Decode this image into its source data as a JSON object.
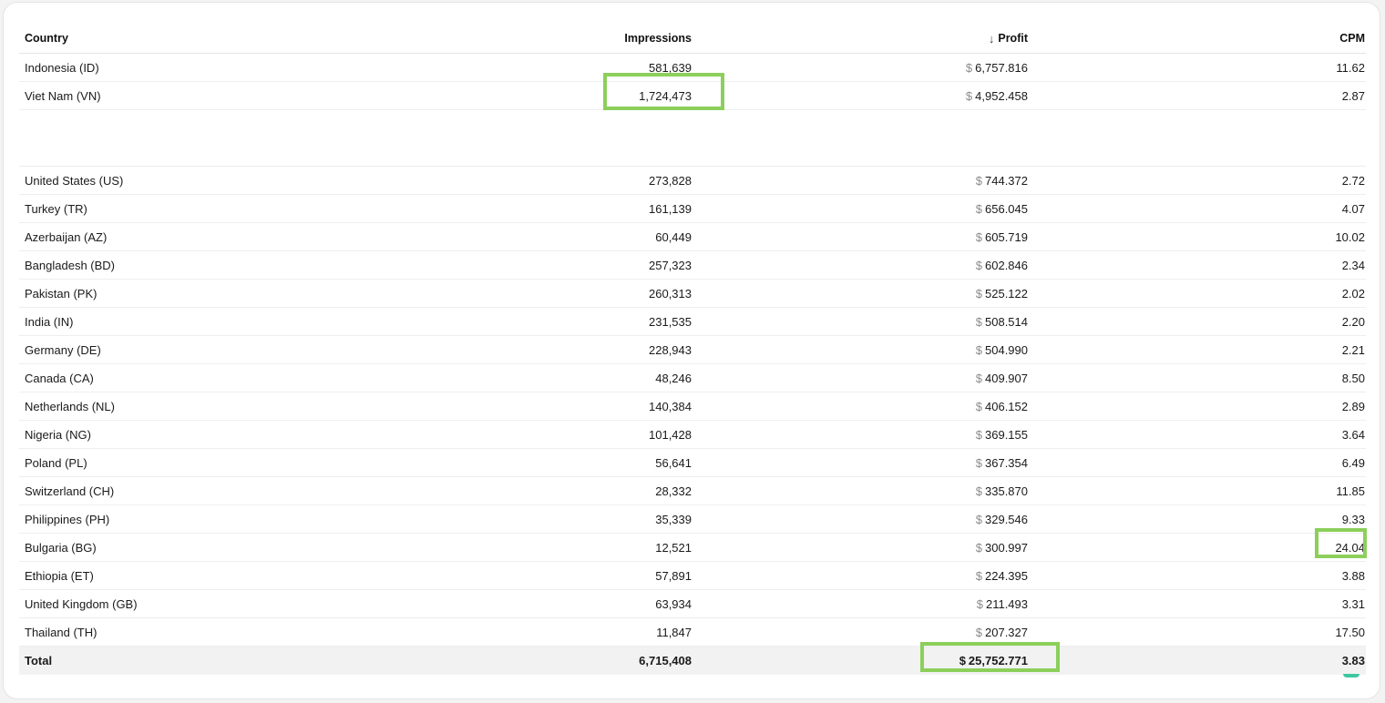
{
  "table": {
    "headers": {
      "country": "Country",
      "impressions": "Impressions",
      "profit": "Profit",
      "cpm": "CPM",
      "sort_icon": "arrow-down-icon"
    },
    "currency_symbol": "$",
    "rows_top": [
      {
        "country": "Indonesia (ID)",
        "impressions": "581,639",
        "profit": "6,757.816",
        "cpm": "11.62"
      },
      {
        "country": "Viet Nam (VN)",
        "impressions": "1,724,473",
        "profit": "4,952.458",
        "cpm": "2.87"
      }
    ],
    "rows": [
      {
        "country": "United States (US)",
        "impressions": "273,828",
        "profit": "744.372",
        "cpm": "2.72"
      },
      {
        "country": "Turkey (TR)",
        "impressions": "161,139",
        "profit": "656.045",
        "cpm": "4.07"
      },
      {
        "country": "Azerbaijan (AZ)",
        "impressions": "60,449",
        "profit": "605.719",
        "cpm": "10.02"
      },
      {
        "country": "Bangladesh (BD)",
        "impressions": "257,323",
        "profit": "602.846",
        "cpm": "2.34"
      },
      {
        "country": "Pakistan (PK)",
        "impressions": "260,313",
        "profit": "525.122",
        "cpm": "2.02"
      },
      {
        "country": "India (IN)",
        "impressions": "231,535",
        "profit": "508.514",
        "cpm": "2.20"
      },
      {
        "country": "Germany (DE)",
        "impressions": "228,943",
        "profit": "504.990",
        "cpm": "2.21"
      },
      {
        "country": "Canada (CA)",
        "impressions": "48,246",
        "profit": "409.907",
        "cpm": "8.50"
      },
      {
        "country": "Netherlands (NL)",
        "impressions": "140,384",
        "profit": "406.152",
        "cpm": "2.89"
      },
      {
        "country": "Nigeria (NG)",
        "impressions": "101,428",
        "profit": "369.155",
        "cpm": "3.64"
      },
      {
        "country": "Poland (PL)",
        "impressions": "56,641",
        "profit": "367.354",
        "cpm": "6.49"
      },
      {
        "country": "Switzerland (CH)",
        "impressions": "28,332",
        "profit": "335.870",
        "cpm": "11.85"
      },
      {
        "country": "Philippines (PH)",
        "impressions": "35,339",
        "profit": "329.546",
        "cpm": "9.33"
      },
      {
        "country": "Bulgaria (BG)",
        "impressions": "12,521",
        "profit": "300.997",
        "cpm": "24.04"
      },
      {
        "country": "Ethiopia (ET)",
        "impressions": "57,891",
        "profit": "224.395",
        "cpm": "3.88"
      },
      {
        "country": "United Kingdom (GB)",
        "impressions": "63,934",
        "profit": "211.493",
        "cpm": "3.31"
      },
      {
        "country": "Thailand (TH)",
        "impressions": "11,847",
        "profit": "207.327",
        "cpm": "17.50"
      }
    ],
    "total": {
      "country": "Total",
      "impressions": "6,715,408",
      "profit": "25,752.771",
      "cpm": "3.83"
    }
  },
  "highlight_color": "#8ccf5b"
}
